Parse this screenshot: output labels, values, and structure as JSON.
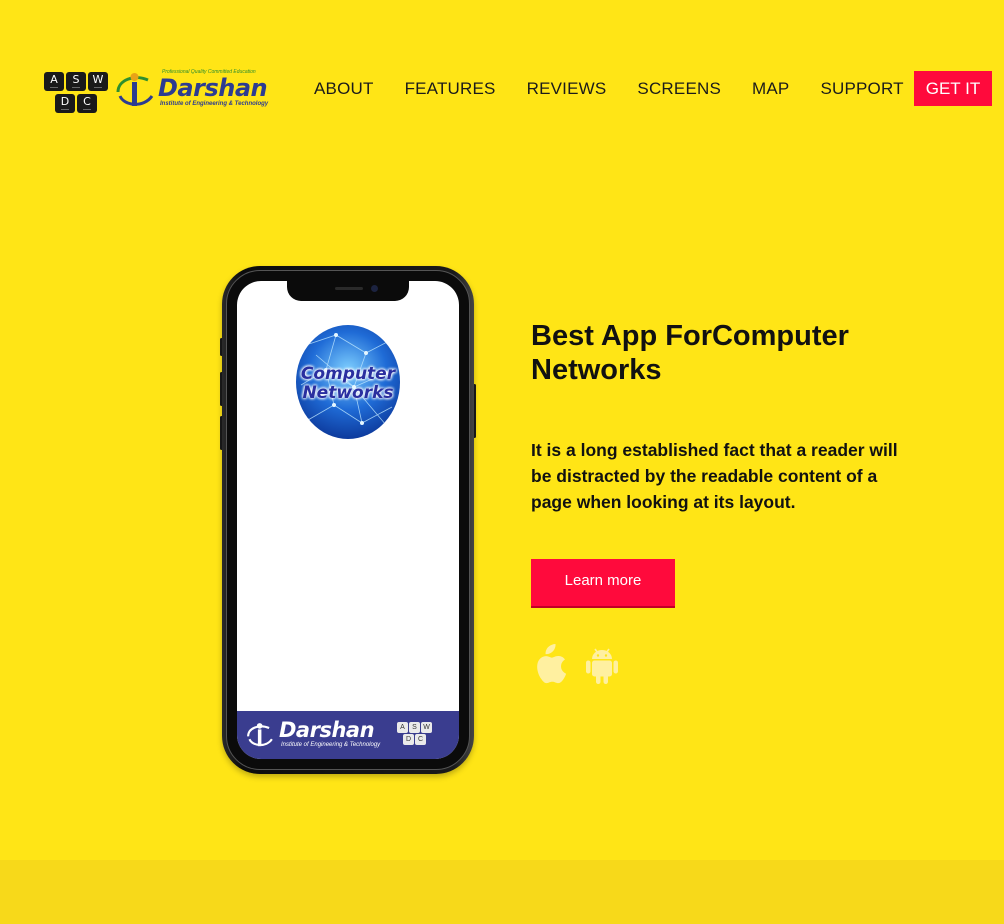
{
  "header": {
    "logo": {
      "aswdc_keys": [
        "A",
        "S",
        "W",
        "D",
        "C"
      ],
      "brand_name": "Darshan",
      "brand_tagline": "Professional Quality Committed Education",
      "brand_subtitle": "Institute of Engineering & Technology"
    },
    "nav": {
      "items": [
        {
          "label": "ABOUT"
        },
        {
          "label": "FEATURES"
        },
        {
          "label": "REVIEWS"
        },
        {
          "label": "SCREENS"
        },
        {
          "label": "MAP"
        },
        {
          "label": "SUPPORT"
        }
      ],
      "cta_label": "GET IT"
    }
  },
  "phone": {
    "app_logo_line1": "Computer",
    "app_logo_line2": "Networks",
    "footer_brand": "Darshan",
    "footer_subtitle": "Institute of Engineering & Technology",
    "footer_keys": [
      "A",
      "S",
      "W",
      "D",
      "C"
    ]
  },
  "hero": {
    "title_light": "Best App For",
    "title_bold": "Computer Networks",
    "description": "It is a long established fact that a reader will be distracted by the readable content of a page when looking at its layout.",
    "cta_label": "Learn more",
    "store_icons": [
      "apple-icon",
      "android-icon"
    ]
  },
  "colors": {
    "background": "#ffe516",
    "accent": "#ff0a3c",
    "brand_blue": "#2d3c91"
  }
}
